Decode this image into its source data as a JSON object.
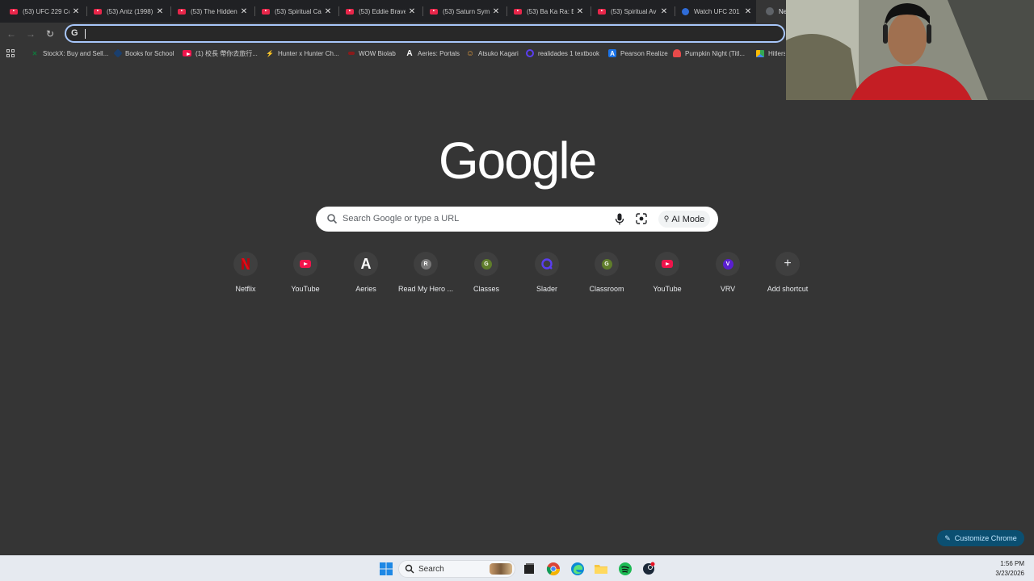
{
  "tabs": [
    {
      "title": "(53) UFC 229 Co",
      "icon": "youtube-icon"
    },
    {
      "title": "(53) Antz (1998)",
      "icon": "youtube-icon"
    },
    {
      "title": "(53) The Hidden",
      "icon": "youtube-icon"
    },
    {
      "title": "(53) Spiritual Ca",
      "icon": "youtube-icon"
    },
    {
      "title": "(53) Eddie Brave",
      "icon": "youtube-icon"
    },
    {
      "title": "(53) Saturn Sym",
      "icon": "youtube-icon"
    },
    {
      "title": "(53) Ba Ka Ra: B",
      "icon": "youtube-icon"
    },
    {
      "title": "(53) Spiritual Av",
      "icon": "youtube-icon"
    },
    {
      "title": "Watch UFC 201",
      "icon": "site-icon"
    },
    {
      "title": "Ne",
      "icon": "chrome-icon"
    }
  ],
  "toolbar": {
    "back": "←",
    "forward": "→",
    "reload": "↻",
    "omnibox_value": "",
    "omnibox_icon": "G"
  },
  "bookmarks": [
    {
      "label": "StockX: Buy and Sell...",
      "icon": "stockx-icon",
      "glyph": "X",
      "color": "#0f7a3c"
    },
    {
      "label": "Books for School",
      "icon": "book-icon",
      "glyph": "",
      "color": "#1a3f6e"
    },
    {
      "label": "(1) 校長 帶你去旅行...",
      "icon": "youtube-icon",
      "glyph": "",
      "color": "#f0144b"
    },
    {
      "label": "Hunter x Hunter Ch...",
      "icon": "lightning-icon",
      "glyph": "⚡",
      "color": "transparent"
    },
    {
      "label": "WOW Biolab",
      "icon": "wow-icon",
      "glyph": "",
      "color": "#8a1a1a"
    },
    {
      "label": "Aeries: Portals",
      "icon": "aeries-icon",
      "glyph": "A",
      "color": "transparent"
    },
    {
      "label": "Atsuko Kagari",
      "icon": "face-icon",
      "glyph": "☺",
      "color": "transparent"
    },
    {
      "label": "realidades 1 textbook",
      "icon": "slader-icon",
      "glyph": "",
      "color": "#5a3ef0"
    },
    {
      "label": "Pearson Realize",
      "icon": "pearson-icon",
      "glyph": "A",
      "color": "#1a73e8"
    },
    {
      "label": "Pumpkin Night (Titl...",
      "icon": "pumpkin-icon",
      "glyph": "",
      "color": "#e84a4a"
    },
    {
      "label": "Hitlers",
      "icon": "drive-icon",
      "glyph": "",
      "color": "#34a853"
    }
  ],
  "logo": "Google",
  "search": {
    "placeholder": "Search Google or type a URL",
    "ai_mode_label": "AI Mode"
  },
  "shortcuts": [
    {
      "label": "Netflix",
      "icon": "netflix-icon"
    },
    {
      "label": "YouTube",
      "icon": "youtube-icon"
    },
    {
      "label": "Aeries",
      "icon": "aeries-icon",
      "letter": "A"
    },
    {
      "label": "Read My Hero ...",
      "icon": "letter-r-icon",
      "letter": "R",
      "color": "#777777"
    },
    {
      "label": "Classes",
      "icon": "letter-g-icon",
      "letter": "G",
      "color": "#5f7d2b"
    },
    {
      "label": "Slader",
      "icon": "slader-icon"
    },
    {
      "label": "Classroom",
      "icon": "letter-g-icon",
      "letter": "G",
      "color": "#5f7d2b"
    },
    {
      "label": "YouTube",
      "icon": "youtube-icon"
    },
    {
      "label": "VRV",
      "icon": "letter-v-icon",
      "letter": "V",
      "color": "#5a1fd0"
    },
    {
      "label": "Add shortcut",
      "icon": "plus-icon",
      "letter": "+"
    }
  ],
  "customize_label": "Customize Chrome",
  "taskbar": {
    "search_label": "Search",
    "time": "1:56 PM",
    "date": "3/23/2026"
  },
  "colors": {
    "background": "#353535",
    "accent": "#a8c7fa",
    "customize_bg": "#0b4f71"
  }
}
